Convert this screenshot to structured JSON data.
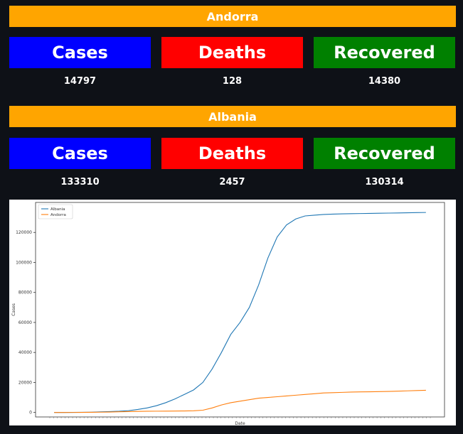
{
  "sections": [
    {
      "country": "Andorra",
      "labels": {
        "cases": "Cases",
        "deaths": "Deaths",
        "recovered": "Recovered"
      },
      "values": {
        "cases": "14797",
        "deaths": "128",
        "recovered": "14380"
      }
    },
    {
      "country": "Albania",
      "labels": {
        "cases": "Cases",
        "deaths": "Deaths",
        "recovered": "Recovered"
      },
      "values": {
        "cases": "133310",
        "deaths": "2457",
        "recovered": "130314"
      }
    }
  ],
  "colors": {
    "country_bar": "#ffa500",
    "cases": "#0000ff",
    "deaths": "#ff0000",
    "recovered": "#008000",
    "series_albania": "#1f77b4",
    "series_andorra": "#ff7f0e"
  },
  "chart_data": {
    "type": "line",
    "xlabel": "Date",
    "ylabel": "Cases",
    "ylim": [
      -3000,
      140000
    ],
    "yticks": [
      0,
      20000,
      40000,
      60000,
      80000,
      100000,
      120000
    ],
    "legend": "top-left",
    "grid": false,
    "x": [
      0,
      5,
      10,
      15,
      20,
      25,
      30,
      35,
      40,
      45,
      50,
      55,
      60,
      65,
      70,
      75,
      80,
      85,
      90,
      95,
      100,
      105,
      110,
      115,
      120,
      125,
      130,
      135,
      140,
      145,
      150,
      155,
      160,
      165,
      170,
      175,
      180,
      185,
      190,
      195,
      200
    ],
    "series": [
      {
        "name": "Albania",
        "values": [
          0,
          0,
          50,
          100,
          200,
          400,
          600,
          800,
          1200,
          2000,
          3000,
          4500,
          6500,
          9000,
          12000,
          15000,
          20000,
          29000,
          40000,
          52000,
          60000,
          70000,
          85000,
          103000,
          117000,
          125000,
          129000,
          131000,
          131500,
          132000,
          132200,
          132400,
          132500,
          132600,
          132700,
          132800,
          132900,
          133000,
          133100,
          133200,
          133310
        ],
        "color_key": "series_albania"
      },
      {
        "name": "Andorra",
        "values": [
          0,
          0,
          20,
          50,
          100,
          200,
          300,
          450,
          600,
          700,
          800,
          850,
          900,
          950,
          1000,
          1100,
          1500,
          3000,
          5000,
          6500,
          7500,
          8500,
          9500,
          10000,
          10500,
          11000,
          11500,
          12000,
          12500,
          13000,
          13200,
          13400,
          13600,
          13700,
          13800,
          13900,
          14000,
          14200,
          14400,
          14600,
          14797
        ],
        "color_key": "series_andorra"
      }
    ]
  }
}
